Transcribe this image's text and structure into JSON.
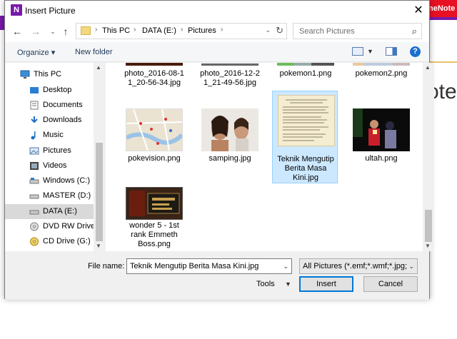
{
  "background": {
    "app_label": "neNote",
    "logo_fragment": "ote"
  },
  "dialog": {
    "title": "Insert Picture",
    "title_icon": "N",
    "close_label": "✕"
  },
  "address": {
    "crumbs": [
      "This PC",
      "DATA (E:)",
      "Pictures"
    ],
    "search_placeholder": "Search Pictures"
  },
  "toolbar": {
    "organize_label": "Organize ▾",
    "new_folder_label": "New folder",
    "help_label": "?"
  },
  "sidebar": {
    "items": [
      {
        "label": "This PC",
        "icon": "pc-icon"
      },
      {
        "label": "Desktop",
        "icon": "desktop-icon"
      },
      {
        "label": "Documents",
        "icon": "documents-icon"
      },
      {
        "label": "Downloads",
        "icon": "downloads-icon"
      },
      {
        "label": "Music",
        "icon": "music-icon"
      },
      {
        "label": "Pictures",
        "icon": "pictures-icon"
      },
      {
        "label": "Videos",
        "icon": "videos-icon"
      },
      {
        "label": "Windows (C:)",
        "icon": "drive-icon"
      },
      {
        "label": "MASTER (D:)",
        "icon": "drive-icon"
      },
      {
        "label": "DATA (E:)",
        "icon": "drive-icon"
      },
      {
        "label": "DVD RW Drive (F",
        "icon": "dvd-icon"
      },
      {
        "label": "CD Drive (G:)",
        "icon": "cd-icon"
      }
    ],
    "selected_index": 9
  },
  "files": [
    {
      "name": "photo_2016-08-1 1_20-56-34.jpg",
      "thumb": "photo-thumb"
    },
    {
      "name": "photo_2016-12-2 1_21-49-56.jpg",
      "thumb": "photo-thumb"
    },
    {
      "name": "pokemon1.png",
      "thumb": "screenshot-thumb"
    },
    {
      "name": "pokemon2.png",
      "thumb": "screenshot-thumb"
    },
    {
      "name": "pokevision.png",
      "thumb": "map-thumb"
    },
    {
      "name": "samping.jpg",
      "thumb": "portrait-thumb"
    },
    {
      "name": "Teknik Mengutip Berita Masa Kini.jpg",
      "thumb": "document-thumb"
    },
    {
      "name": "ultah.png",
      "thumb": "night-photo-thumb"
    },
    {
      "name": "wonder 5 - 1st rank Emmeth Boss.png",
      "thumb": "game-thumb"
    }
  ],
  "selected_file": "Teknik Mengutip Berita Masa Kini.jpg",
  "footer": {
    "file_name_label": "File name:",
    "file_name_value": "Teknik Mengutip Berita Masa Kini.jpg",
    "file_type_value": "All Pictures (*.emf;*.wmf;*.jpg;*",
    "tools_label": "Tools",
    "insert_label": "Insert",
    "cancel_label": "Cancel"
  }
}
